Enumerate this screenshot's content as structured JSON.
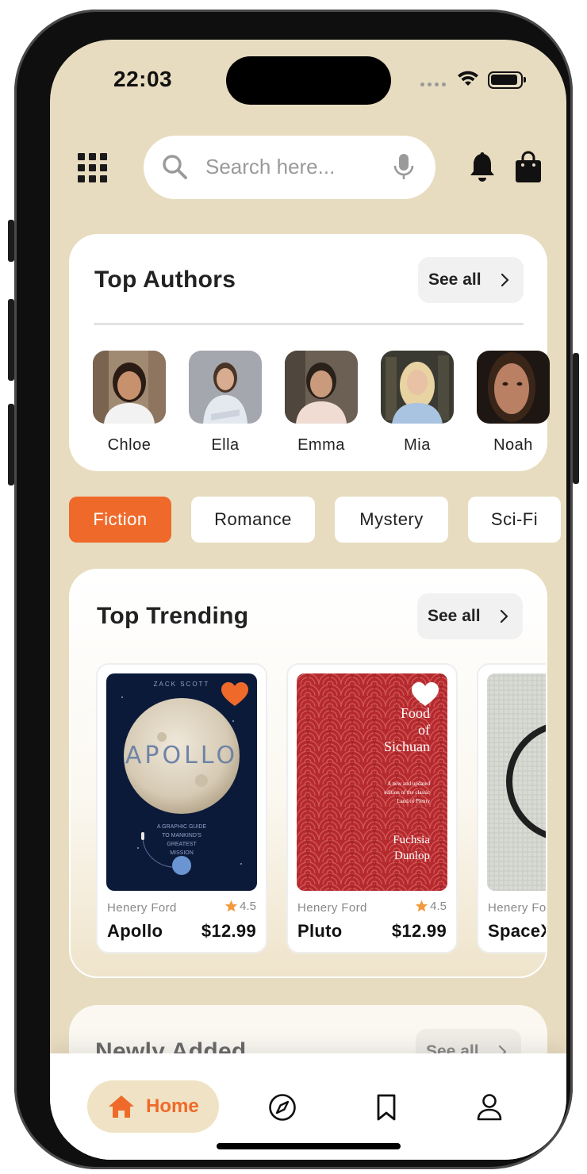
{
  "status_bar": {
    "time": "22:03"
  },
  "header": {
    "search": {
      "placeholder": "Search here..."
    }
  },
  "top_authors": {
    "title": "Top Authors",
    "see_all_label": "See all",
    "authors": [
      {
        "name": "Chloe"
      },
      {
        "name": "Ella"
      },
      {
        "name": "Emma"
      },
      {
        "name": "Mia"
      },
      {
        "name": "Noah"
      }
    ]
  },
  "genres": [
    {
      "label": "Fiction",
      "active": true
    },
    {
      "label": "Romance",
      "active": false
    },
    {
      "label": "Mystery",
      "active": false
    },
    {
      "label": "Sci-Fi",
      "active": false
    }
  ],
  "top_trending": {
    "title": "Top Trending",
    "see_all_label": "See all",
    "books": [
      {
        "author": "Henery Ford",
        "rating": "4.5",
        "title": "Apollo",
        "price": "$12.99",
        "favorited": true,
        "cover": {
          "author_line": "ZACK SCOTT",
          "title": "APOLLO",
          "tagline": "A GRAPHIC GUIDE TO MANKIND'S GREATEST MISSION"
        }
      },
      {
        "author": "Henery Ford",
        "rating": "4.5",
        "title": "Pluto",
        "price": "$12.99",
        "favorited": false,
        "cover": {
          "title_top": "T",
          "title_line2": "Food",
          "title_line3": "of",
          "title_line4": "Sichuan",
          "blurb": "A new and updated edition of the classic Land of Plenty",
          "author_first": "Fuchsia",
          "author_last": "Dunlop"
        }
      },
      {
        "author": "Henery Fo",
        "title": "SpaceX"
      }
    ]
  },
  "newly_added": {
    "title": "Newly Added",
    "see_all_label": "See all"
  },
  "tab_bar": {
    "home_label": "Home",
    "tabs": [
      "home-icon",
      "compass-icon",
      "bookmark-icon",
      "profile-icon"
    ]
  },
  "colors": {
    "background": "#e8dcc0",
    "accent": "#ef6a2a",
    "active_tab_bg": "#f0e2c4",
    "card": "#ffffff"
  }
}
